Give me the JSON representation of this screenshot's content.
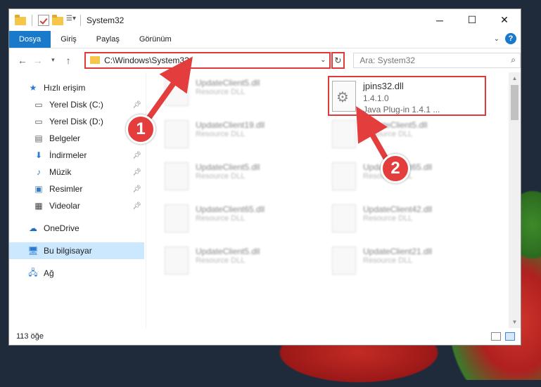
{
  "window": {
    "title": "System32"
  },
  "ribbon": {
    "tabs": [
      "Dosya",
      "Giriş",
      "Paylaş",
      "Görünüm"
    ],
    "help": "?"
  },
  "nav": {
    "address": "C:\\Windows\\System32",
    "search_placeholder": "Ara: System32"
  },
  "sidebar": {
    "items": [
      {
        "label": "Hızlı erişim",
        "icon": "star-icon"
      },
      {
        "label": "Yerel Disk (C:)",
        "icon": "drive-icon",
        "pinned": true
      },
      {
        "label": "Yerel Disk (D:)",
        "icon": "drive-icon"
      },
      {
        "label": "Belgeler",
        "icon": "documents-icon"
      },
      {
        "label": "İndirmeler",
        "icon": "download-icon",
        "pinned": true
      },
      {
        "label": "Müzik",
        "icon": "music-icon",
        "pinned": true
      },
      {
        "label": "Resimler",
        "icon": "pictures-icon",
        "pinned": true
      },
      {
        "label": "Videolar",
        "icon": "videos-icon",
        "pinned": true
      },
      {
        "label": "OneDrive",
        "icon": "cloud-icon"
      },
      {
        "label": "Bu bilgisayar",
        "icon": "computer-icon",
        "selected": true
      },
      {
        "label": "Ağ",
        "icon": "network-icon"
      }
    ]
  },
  "files": {
    "highlighted": {
      "name": "jpins32.dll",
      "version": "1.4.1.0",
      "description": "Java Plug-in 1.4.1 ..."
    },
    "background": [
      {
        "name": "UpdateClient5.dll",
        "type": "Resource DLL"
      },
      {
        "name": "UpdateClient19.dll",
        "type": "Resource DLL"
      },
      {
        "name": "UpdateClient5.dll",
        "type": "Resource DLL"
      },
      {
        "name": "UpdateClient5.dll",
        "type": "Resource DLL"
      },
      {
        "name": "UpdateClient65.dll",
        "type": "Resource DLL"
      },
      {
        "name": "UpdateClient65.dll",
        "type": "Resource DLL"
      },
      {
        "name": "UpdateClient42.dll",
        "type": "Resource DLL"
      },
      {
        "name": "UpdateClient5.dll",
        "type": "Resource DLL"
      },
      {
        "name": "UpdateClient21.dll",
        "type": "Resource DLL"
      }
    ]
  },
  "status": {
    "count": "113 öğe"
  },
  "annotations": {
    "step1": "1",
    "step2": "2",
    "color": "#e33d3d"
  }
}
